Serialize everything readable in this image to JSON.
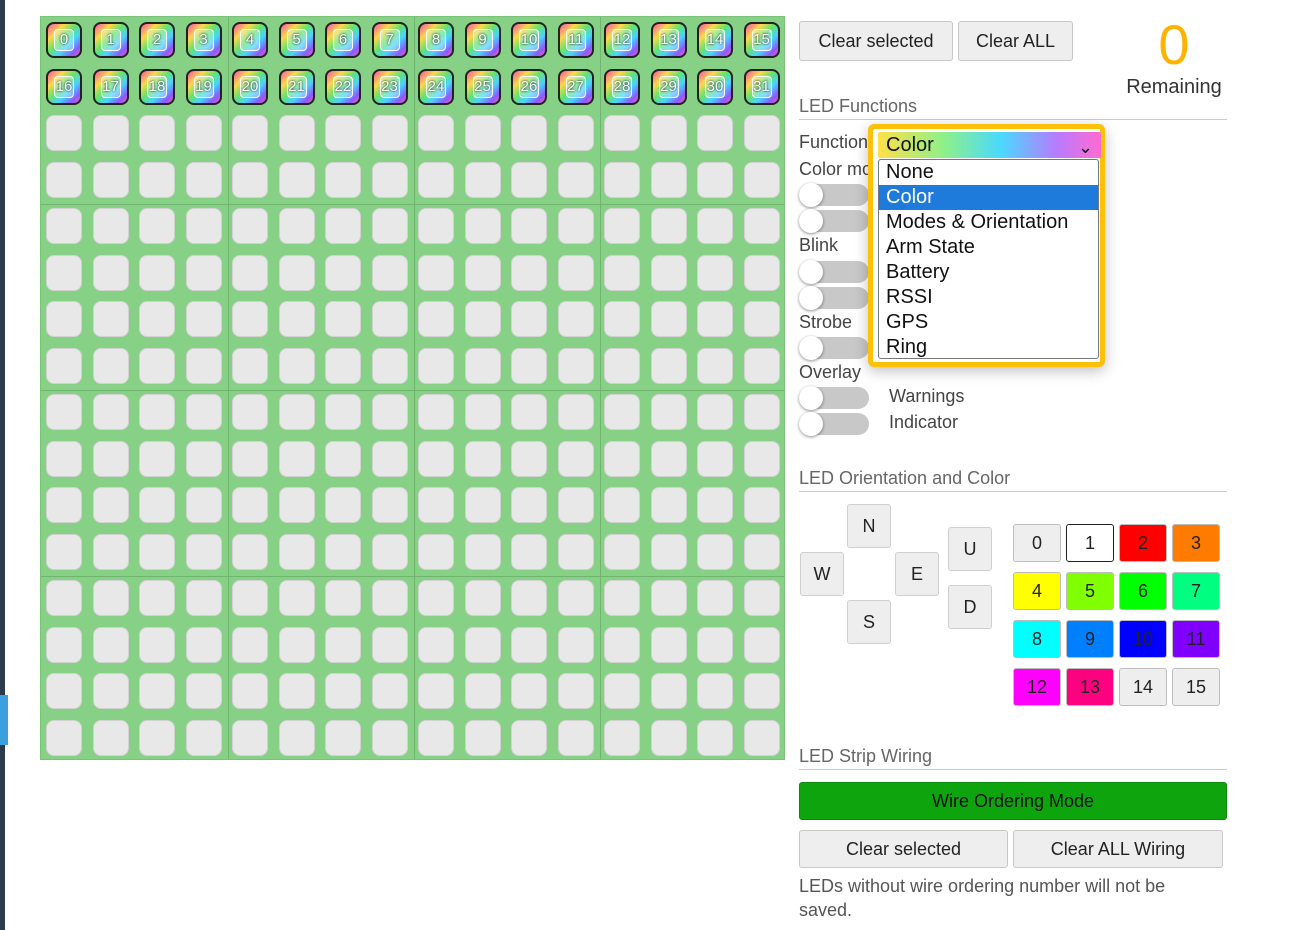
{
  "header": {
    "clear_selected": "Clear selected",
    "clear_all": "Clear ALL",
    "remaining_value": "0",
    "remaining_label": "Remaining"
  },
  "grid": {
    "rows": 16,
    "cols": 16,
    "active_labels": [
      "0",
      "1",
      "2",
      "3",
      "4",
      "5",
      "6",
      "7",
      "8",
      "9",
      "10",
      "11",
      "12",
      "13",
      "14",
      "15",
      "16",
      "17",
      "18",
      "19",
      "20",
      "21",
      "22",
      "23",
      "24",
      "25",
      "26",
      "27",
      "28",
      "29",
      "30",
      "31"
    ]
  },
  "led_functions": {
    "title": "LED Functions",
    "function_label": "Function",
    "function_value": "Color",
    "options": [
      "None",
      "Color",
      "Modes & Orientation",
      "Arm State",
      "Battery",
      "RSSI",
      "GPS",
      "Ring"
    ],
    "selected_option": "Color",
    "color_modifier_label": "Color mo",
    "blink_label": "Blink",
    "strobe_label": "Strobe",
    "overlay_label": "Overlay",
    "overlay_warnings": "Warnings",
    "overlay_indicator": "Indicator"
  },
  "orientation": {
    "title": "LED Orientation and Color",
    "n": "N",
    "w": "W",
    "e": "E",
    "s": "S",
    "u": "U",
    "d": "D"
  },
  "colors": [
    {
      "label": "0",
      "bg": "#eeeeee",
      "fg": "#222222"
    },
    {
      "label": "1",
      "bg": "#ffffff",
      "fg": "#222222"
    },
    {
      "label": "2",
      "bg": "#ff0000",
      "fg": "#222222"
    },
    {
      "label": "3",
      "bg": "#ff7b00",
      "fg": "#222222"
    },
    {
      "label": "4",
      "bg": "#ffff00",
      "fg": "#222222"
    },
    {
      "label": "5",
      "bg": "#80ff00",
      "fg": "#222222"
    },
    {
      "label": "6",
      "bg": "#00ff00",
      "fg": "#222222"
    },
    {
      "label": "7",
      "bg": "#00ff80",
      "fg": "#222222"
    },
    {
      "label": "8",
      "bg": "#00ffff",
      "fg": "#222222"
    },
    {
      "label": "9",
      "bg": "#0080ff",
      "fg": "#222222"
    },
    {
      "label": "10",
      "bg": "#0000ff",
      "fg": "#222222"
    },
    {
      "label": "11",
      "bg": "#8000ff",
      "fg": "#222222"
    },
    {
      "label": "12",
      "bg": "#ff00ff",
      "fg": "#222222"
    },
    {
      "label": "13",
      "bg": "#ff0080",
      "fg": "#222222"
    },
    {
      "label": "14",
      "bg": "#eeeeee",
      "fg": "#222222"
    },
    {
      "label": "15",
      "bg": "#eeeeee",
      "fg": "#222222"
    }
  ],
  "wiring": {
    "title": "LED Strip Wiring",
    "wire_mode": "Wire Ordering Mode",
    "clear_selected": "Clear selected",
    "clear_all": "Clear ALL Wiring",
    "note": "LEDs without wire ordering number will not be saved."
  },
  "accent_colors": {
    "remaining": "#ffb300",
    "dropdown_highlight": "#ffc107",
    "wire_mode": "#0ea40e"
  }
}
